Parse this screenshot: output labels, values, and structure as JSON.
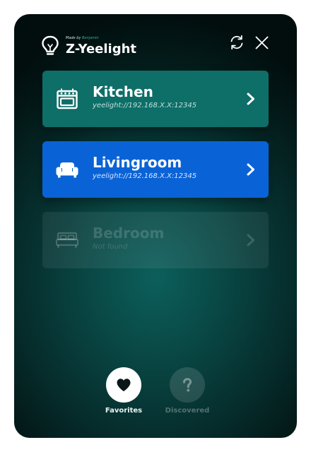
{
  "app": {
    "made_by_prefix": "Made by",
    "made_by_author": "Benjamin",
    "title": "Z-Yeelight"
  },
  "header": {
    "refresh_icon": "refresh-icon",
    "close_icon": "close-icon",
    "logo_icon": "lightbulb-icon"
  },
  "devices": [
    {
      "name": "Kitchen",
      "url": "yeelight://192.168.X.X:12345",
      "icon": "stove-icon",
      "state": "default",
      "color": "#0e6e68"
    },
    {
      "name": "Livingroom",
      "url": "yeelight://192.168.X.X:12345",
      "icon": "sofa-icon",
      "state": "selected",
      "color": "#0a63d6"
    },
    {
      "name": "Bedroom",
      "url": "Not found",
      "icon": "bed-icon",
      "state": "disabled",
      "color": "#ffffff12"
    }
  ],
  "tabs": [
    {
      "label": "Favorites",
      "icon": "heart-icon",
      "active": true
    },
    {
      "label": "Discovered",
      "icon": "question-icon",
      "active": false
    }
  ]
}
